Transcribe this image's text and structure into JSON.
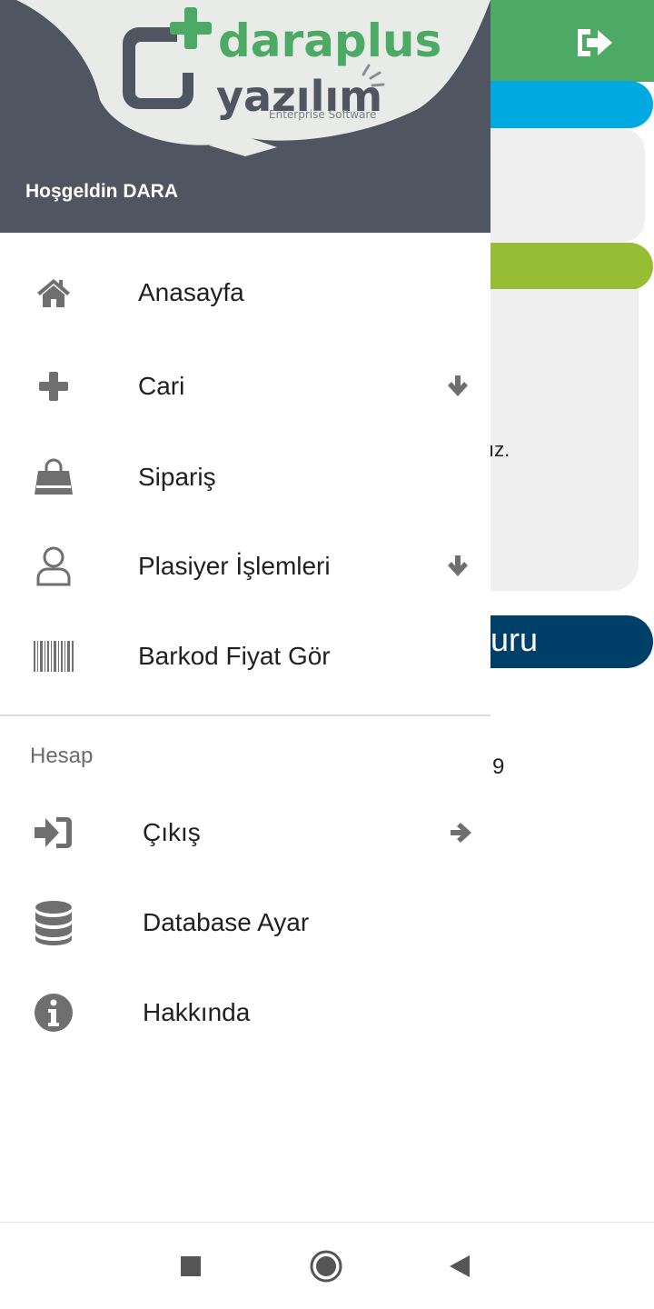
{
  "background": {
    "card_text": "ız.",
    "navy_button_text": "uru",
    "number_text": "9",
    "colors": {
      "topbar": "#4caa64",
      "blue": "#00a9df",
      "green": "#97bd35",
      "navy": "#003f67"
    }
  },
  "drawer": {
    "header": {
      "logo_text": "daraplus",
      "logo_subtext": "yazılım",
      "logo_tagline": "Enterprise Software",
      "welcome": "Hoşgeldin DARA"
    },
    "items": [
      {
        "label": "Anasayfa",
        "icon": "home-icon",
        "expandable": false
      },
      {
        "label": "Cari",
        "icon": "plus-icon",
        "expandable": true
      },
      {
        "label": "Sipariş",
        "icon": "shopping-bag-icon",
        "expandable": false
      },
      {
        "label": "Plasiyer İşlemleri",
        "icon": "user-icon",
        "expandable": true
      },
      {
        "label": "Barkod Fiyat Gör",
        "icon": "barcode-icon",
        "expandable": false
      }
    ],
    "account_section": {
      "title": "Hesap",
      "items": [
        {
          "label": "Çıkış",
          "icon": "sign-in-icon",
          "arrow": "arrow-right-icon"
        },
        {
          "label": "Database Ayar",
          "icon": "database-icon"
        },
        {
          "label": "Hakkında",
          "icon": "info-icon"
        }
      ]
    }
  },
  "system_nav": [
    "recents-button",
    "home-button",
    "back-button"
  ]
}
